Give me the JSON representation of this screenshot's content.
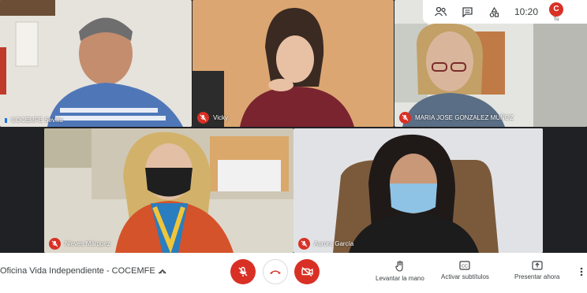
{
  "participants": [
    {
      "name": "COCEMFE Sevilla",
      "muted": false
    },
    {
      "name": "Vicky",
      "muted": true
    },
    {
      "name": "MARIA JOSE GONZALEZ MUÑOZ",
      "muted": true
    },
    {
      "name": "Nieves Márquez",
      "muted": true
    },
    {
      "name": "Aurora García",
      "muted": true
    }
  ],
  "topbar": {
    "clock": "10:20",
    "self_initial": "C",
    "self_label": "Tú"
  },
  "bottombar": {
    "meeting_title": "Oficina Vida Independiente - COCEMFE ...",
    "actions": {
      "raise_hand": "Levantar la mano",
      "captions": "Activar subtítulos",
      "present": "Presentar ahora"
    }
  },
  "colors": {
    "mute_red": "#d93025",
    "bar_bg": "#ffffff",
    "text_dark": "#3c4043"
  }
}
